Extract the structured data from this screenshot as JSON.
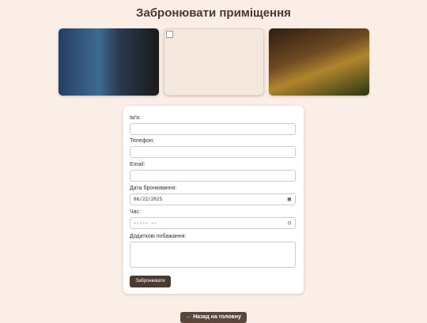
{
  "page": {
    "title": "Забронювати приміщення"
  },
  "gallery": [
    {
      "name": "building-photo"
    },
    {
      "name": "broken-image"
    },
    {
      "name": "restaurant-interior-photo"
    }
  ],
  "form": {
    "name_label": "Ім'я:",
    "name_value": "",
    "phone_label": "Телефон:",
    "phone_value": "",
    "email_label": "Email:",
    "email_value": "",
    "date_label": "Дата бронювання:",
    "date_value": "06/22/2025",
    "date_icon": "calendar-icon",
    "time_label": "Час:",
    "time_value": "--:-- --",
    "time_icon": "clock-icon",
    "notes_label": "Додаткові побажання:",
    "notes_value": "",
    "submit_label": "Забронювати"
  },
  "nav": {
    "back_label": "← Назад на головну"
  }
}
